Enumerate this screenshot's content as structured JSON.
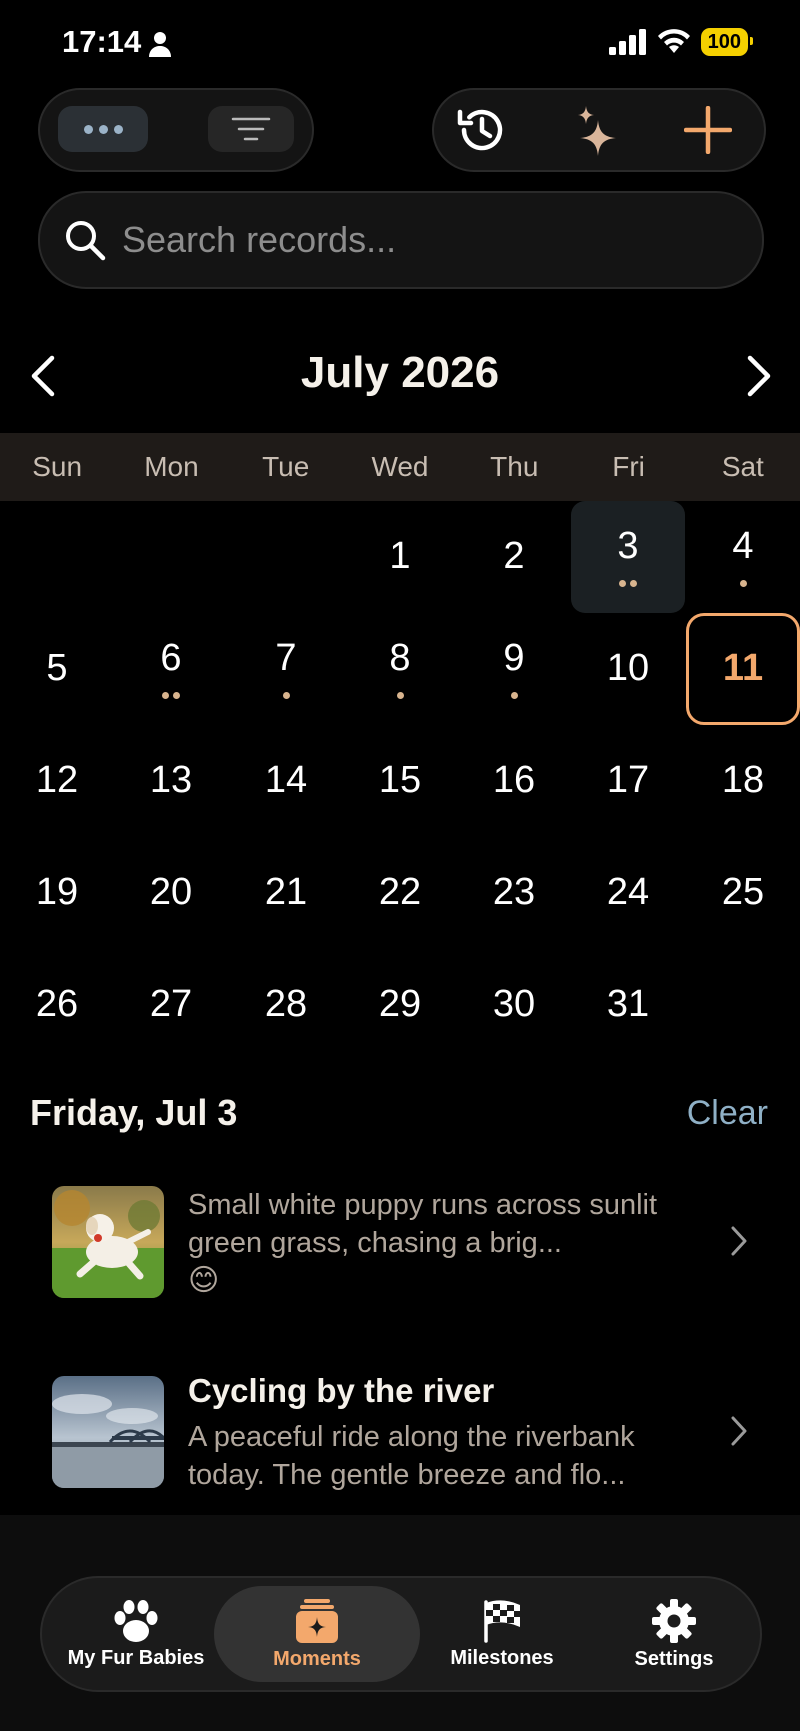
{
  "status": {
    "time": "17:14",
    "battery": "100"
  },
  "search": {
    "placeholder": "Search records..."
  },
  "calendar": {
    "month_title": "July 2026",
    "weekdays": [
      "Sun",
      "Mon",
      "Tue",
      "Wed",
      "Thu",
      "Fri",
      "Sat"
    ],
    "days": [
      "1",
      "2",
      "3",
      "4",
      "5",
      "6",
      "7",
      "8",
      "9",
      "10",
      "11",
      "12",
      "13",
      "14",
      "15",
      "16",
      "17",
      "18",
      "19",
      "20",
      "21",
      "22",
      "23",
      "24",
      "25",
      "26",
      "27",
      "28",
      "29",
      "30",
      "31"
    ],
    "selected_day": "3",
    "today": "11"
  },
  "selection": {
    "title": "Friday, Jul 3",
    "clear_label": "Clear",
    "records": [
      {
        "title": "",
        "body": "Small white puppy runs across sunlit green grass, chasing a brig...",
        "emoji": "😊"
      },
      {
        "title": "Cycling by the river",
        "body": "A peaceful ride along the riverbank today. The gentle breeze and flo..."
      }
    ]
  },
  "tabs": [
    {
      "label": "My Fur Babies",
      "icon": "paw-icon"
    },
    {
      "label": "Moments",
      "icon": "moments-icon"
    },
    {
      "label": "Milestones",
      "icon": "checkered-flag-icon"
    },
    {
      "label": "Settings",
      "icon": "gear-icon"
    }
  ],
  "colors": {
    "accent": "#f3a86c",
    "link": "#8fb0c6",
    "background": "#000000"
  }
}
